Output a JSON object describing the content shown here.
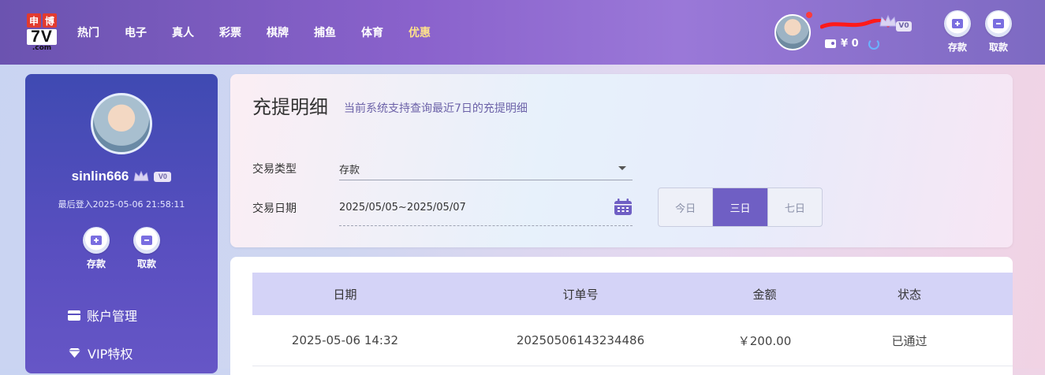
{
  "header": {
    "logo": {
      "top": [
        "申",
        "博"
      ],
      "main": "7V",
      "domain": ".com"
    },
    "nav": [
      {
        "label": "热门"
      },
      {
        "label": "电子"
      },
      {
        "label": "真人"
      },
      {
        "label": "彩票"
      },
      {
        "label": "棋牌"
      },
      {
        "label": "捕鱼"
      },
      {
        "label": "体育"
      },
      {
        "label": "优惠",
        "highlight": true
      }
    ],
    "vip_badge": "V0",
    "balance": "¥ 0",
    "deposit_label": "存款",
    "withdraw_label": "取款"
  },
  "sidebar": {
    "username": "sinlin666",
    "vip_badge": "V0",
    "last_login": "最后登入2025-05-06 21:58:11",
    "deposit_label": "存款",
    "withdraw_label": "取款",
    "menu": [
      {
        "label": "账户管理",
        "icon": "card-icon"
      },
      {
        "label": "VIP特权",
        "icon": "diamond-icon"
      }
    ]
  },
  "filter": {
    "title": "充提明细",
    "subtitle": "当前系统支持查询最近7日的充提明细",
    "type_label": "交易类型",
    "type_value": "存款",
    "date_label": "交易日期",
    "date_value": "2025/05/05~2025/05/07",
    "ranges": [
      {
        "label": "今日",
        "active": false
      },
      {
        "label": "三日",
        "active": true
      },
      {
        "label": "七日",
        "active": false
      }
    ]
  },
  "table": {
    "headers": [
      "日期",
      "订单号",
      "金额",
      "状态"
    ],
    "rows": [
      [
        "2025-05-06 14:32",
        "20250506143234486",
        "￥200.00",
        "已通过"
      ]
    ]
  },
  "colors": {
    "accent": "#6f5fc4",
    "highlight_nav": "#ffe28a",
    "table_header_bg": "#d4d3f7"
  }
}
